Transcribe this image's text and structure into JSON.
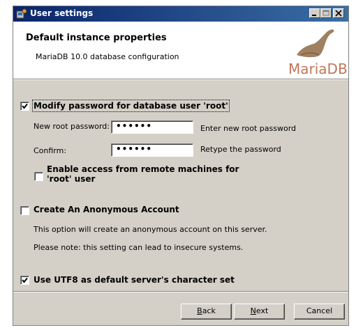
{
  "window": {
    "title": "User settings"
  },
  "header": {
    "title": "Default instance properties",
    "subtitle": "MariaDB 10.0 database configuration",
    "logo_text": "MariaDB"
  },
  "root_password": {
    "checkbox_label": "Modify password for database user 'root'",
    "checked": true,
    "new_label": "New root password:",
    "new_value": "••••••",
    "new_hint": "Enter new root password",
    "confirm_label": "Confirm:",
    "confirm_value": "••••••",
    "confirm_hint": "Retype the password",
    "remote_label_line1": "Enable access from remote machines for",
    "remote_label_line2": "'root' user",
    "remote_checked": false
  },
  "anonymous": {
    "checkbox_label": "Create An Anonymous Account",
    "checked": false,
    "desc1": "This option will create an anonymous account on this server.",
    "desc2": "Please note: this setting can lead to insecure systems."
  },
  "utf8": {
    "checkbox_label": "Use UTF8 as default server's character set",
    "checked": true
  },
  "buttons": {
    "back_first": "B",
    "back_rest": "ack",
    "next_first": "N",
    "next_rest": "ext",
    "cancel": "Cancel"
  },
  "colors": {
    "titlebar_start": "#0a246a",
    "titlebar_end": "#3a6ea5",
    "logo": "#c0765a",
    "dialog_bg": "#d4d0c8"
  }
}
